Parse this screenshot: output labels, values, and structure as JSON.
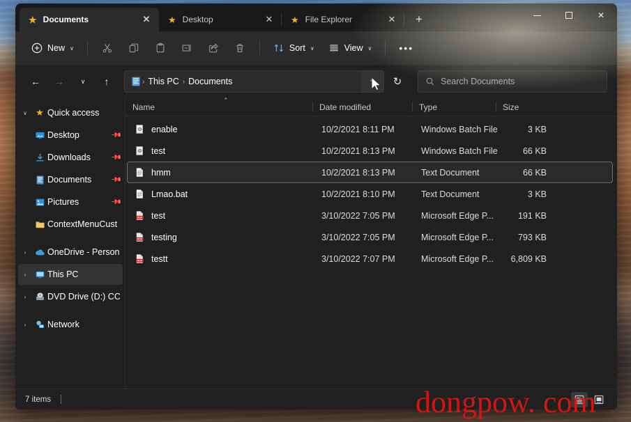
{
  "window": {
    "controls": {
      "minimize": "Minimize",
      "maximize": "Maximize",
      "close": "Close"
    }
  },
  "tabs": {
    "items": [
      {
        "label": "Documents",
        "icon": "star-icon",
        "active": true,
        "close": "✕"
      },
      {
        "label": "Desktop",
        "icon": "star-icon",
        "active": false,
        "close": "✕"
      },
      {
        "label": "File Explorer",
        "icon": "star-icon",
        "active": false,
        "close": "✕"
      }
    ],
    "new_tab_label": "+"
  },
  "toolbar": {
    "new_label": "New",
    "new_caret": "∨",
    "cut_label": "Cut",
    "copy_label": "Copy",
    "paste_label": "Paste",
    "rename_label": "Rename",
    "share_label": "Share",
    "delete_label": "Delete",
    "sort_label": "Sort",
    "sort_caret": "∨",
    "view_label": "View",
    "view_caret": "∨",
    "more_label": "•••"
  },
  "address": {
    "back": "←",
    "forward": "→",
    "recent_caret": "∨",
    "up": "↑",
    "folder_icon": "documents-folder-icon",
    "crumbs": [
      "This PC",
      "Documents"
    ],
    "separator": "›",
    "dropdown_caret": "∨",
    "refresh": "↻"
  },
  "search": {
    "placeholder": "Search Documents",
    "value": "",
    "icon": "search-icon"
  },
  "sidebar": {
    "items": [
      {
        "label": "Quick access",
        "icon": "star-icon",
        "chevron": "∨",
        "indent": false,
        "pinned": false,
        "selected": false
      },
      {
        "label": "Desktop",
        "icon": "desktop-icon",
        "chevron": "",
        "indent": true,
        "pinned": true,
        "selected": false
      },
      {
        "label": "Downloads",
        "icon": "downloads-icon",
        "chevron": "",
        "indent": true,
        "pinned": true,
        "selected": false
      },
      {
        "label": "Documents",
        "icon": "documents-icon",
        "chevron": "",
        "indent": true,
        "pinned": true,
        "selected": false
      },
      {
        "label": "Pictures",
        "icon": "pictures-icon",
        "chevron": "",
        "indent": true,
        "pinned": true,
        "selected": false
      },
      {
        "label": "ContextMenuCust",
        "icon": "folder-icon",
        "chevron": "",
        "indent": true,
        "pinned": false,
        "selected": false
      },
      {
        "label": "OneDrive - Personal",
        "icon": "onedrive-icon",
        "chevron": "›",
        "indent": false,
        "pinned": false,
        "selected": false
      },
      {
        "label": "This PC",
        "icon": "this-pc-icon",
        "chevron": "›",
        "indent": false,
        "pinned": false,
        "selected": true
      },
      {
        "label": "DVD Drive (D:) CCCO",
        "icon": "dvd-drive-icon",
        "chevron": "›",
        "indent": false,
        "pinned": false,
        "selected": false
      },
      {
        "label": "Network",
        "icon": "network-icon",
        "chevron": "›",
        "indent": false,
        "pinned": false,
        "selected": false
      }
    ],
    "pin_glyph": "📌"
  },
  "filelist": {
    "columns": {
      "name": "Name",
      "date": "Date modified",
      "type": "Type",
      "size": "Size"
    },
    "sort_indicator": "⌃",
    "rows": [
      {
        "name": "enable",
        "date": "10/2/2021 8:11 PM",
        "type": "Windows Batch File",
        "size": "3 KB",
        "icon": "batch-file-icon",
        "focused": false
      },
      {
        "name": "test",
        "date": "10/2/2021 8:13 PM",
        "type": "Windows Batch File",
        "size": "66 KB",
        "icon": "batch-file-icon",
        "focused": false
      },
      {
        "name": "hmm",
        "date": "10/2/2021 8:13 PM",
        "type": "Text Document",
        "size": "66 KB",
        "icon": "text-document-icon",
        "focused": true
      },
      {
        "name": "Lmao.bat",
        "date": "10/2/2021 8:10 PM",
        "type": "Text Document",
        "size": "3 KB",
        "icon": "text-document-icon",
        "focused": false
      },
      {
        "name": "test",
        "date": "3/10/2022 7:05 PM",
        "type": "Microsoft Edge P...",
        "size": "191 KB",
        "icon": "pdf-file-icon",
        "focused": false
      },
      {
        "name": "testing",
        "date": "3/10/2022 7:05 PM",
        "type": "Microsoft Edge P...",
        "size": "793 KB",
        "icon": "pdf-file-icon",
        "focused": false
      },
      {
        "name": "testt",
        "date": "3/10/2022 7:07 PM",
        "type": "Microsoft Edge P...",
        "size": "6,809 KB",
        "icon": "pdf-file-icon",
        "focused": false
      }
    ]
  },
  "statusbar": {
    "item_count": "7 items",
    "details_view_label": "Details view",
    "large_icons_view_label": "Large icons view"
  },
  "watermark": {
    "text": "dongpow. com",
    "color": "#e11414"
  },
  "colors": {
    "window_bg": "#202020",
    "titlebar_bg": "#191919",
    "commandbar_bg": "#2b2b2b",
    "accent_star": "#f0b429",
    "selection": "#333333",
    "pdf_red": "#c5211b"
  }
}
